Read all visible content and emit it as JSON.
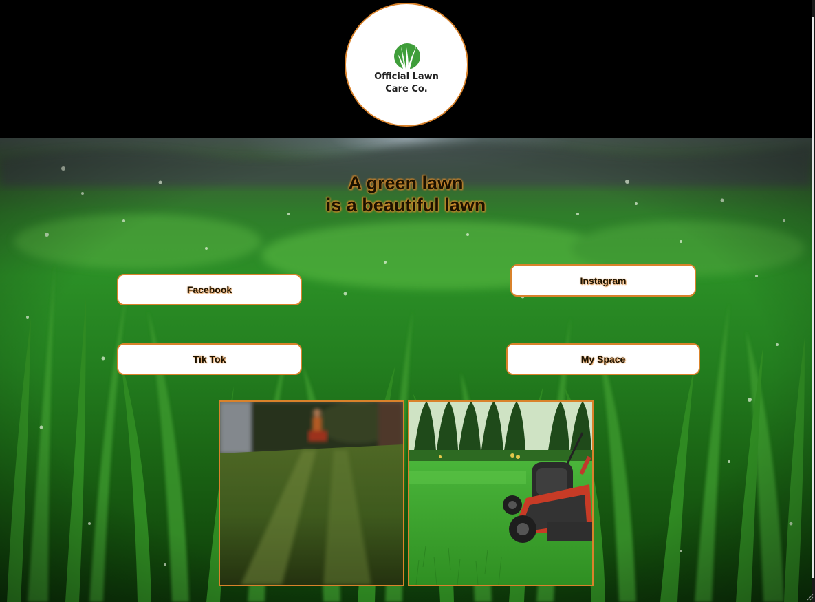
{
  "header": {
    "logo_text_line1": "Official Lawn",
    "logo_text_line2": "Care Co."
  },
  "hero": {
    "headline_line1": "A green lawn",
    "headline_line2": "is a beautiful lawn"
  },
  "social_links": {
    "facebook": "Facebook",
    "instagram": "Instagram",
    "tiktok": "Tik Tok",
    "myspace": "My Space"
  },
  "colors": {
    "accent_orange": "#d9822b",
    "header_bg": "#000000",
    "button_bg": "#ffffff",
    "logo_green": "#3a9a3a"
  },
  "icons": {
    "logo_mark": "grass-leaf-icon"
  }
}
